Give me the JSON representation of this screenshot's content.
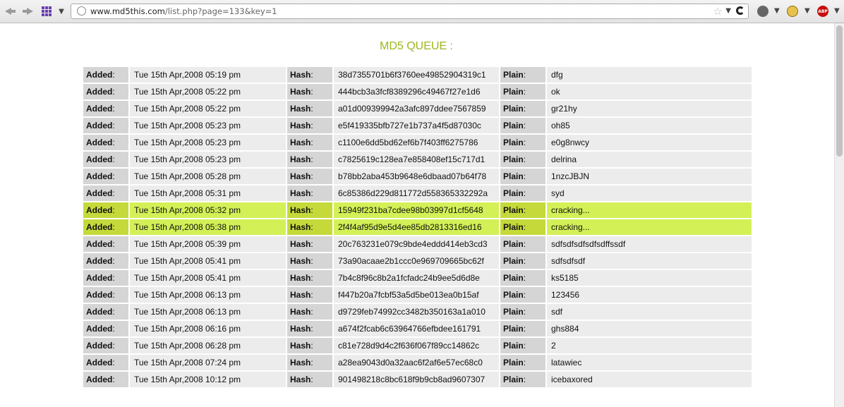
{
  "browser": {
    "url_domain": "www.md5this.com",
    "url_path": "/list.php?page=133&key=1"
  },
  "page": {
    "title": "MD5 QUEUE :"
  },
  "table": {
    "labels": {
      "added": "Added",
      "hash": "Hash",
      "plain": "Plain",
      "separator": ":"
    },
    "rows": [
      {
        "added": "Tue 15th Apr,2008 05:19 pm",
        "hash": "38d7355701b6f3760ee49852904319c1",
        "plain": "dfg",
        "status": "done"
      },
      {
        "added": "Tue 15th Apr,2008 05:22 pm",
        "hash": "444bcb3a3fcf8389296c49467f27e1d6",
        "plain": "ok",
        "status": "done"
      },
      {
        "added": "Tue 15th Apr,2008 05:22 pm",
        "hash": "a01d009399942a3afc897ddee7567859",
        "plain": "gr21hy",
        "status": "done"
      },
      {
        "added": "Tue 15th Apr,2008 05:23 pm",
        "hash": "e5f419335bfb727e1b737a4f5d87030c",
        "plain": "oh85",
        "status": "done"
      },
      {
        "added": "Tue 15th Apr,2008 05:23 pm",
        "hash": "c1100e6dd5bd62ef6b7f403ff6275786",
        "plain": "e0g8nwcy",
        "status": "done"
      },
      {
        "added": "Tue 15th Apr,2008 05:23 pm",
        "hash": "c7825619c128ea7e858408ef15c717d1",
        "plain": "delrina",
        "status": "done"
      },
      {
        "added": "Tue 15th Apr,2008 05:28 pm",
        "hash": "b78bb2aba453b9648e6dbaad07b64f78",
        "plain": "1nzcJBJN",
        "status": "done"
      },
      {
        "added": "Tue 15th Apr,2008 05:31 pm",
        "hash": "6c85386d229d811772d558365332292a",
        "plain": "syd",
        "status": "done"
      },
      {
        "added": "Tue 15th Apr,2008 05:32 pm",
        "hash": "15949f231ba7cdee98b03997d1cf5648",
        "plain": "cracking...",
        "status": "active"
      },
      {
        "added": "Tue 15th Apr,2008 05:38 pm",
        "hash": "2f4f4af95d9e5d4ee85db2813316ed16",
        "plain": "cracking...",
        "status": "active"
      },
      {
        "added": "Tue 15th Apr,2008 05:39 pm",
        "hash": "20c763231e079c9bde4eddd414eb3cd3",
        "plain": "sdfsdfsdfsdfsdffssdf",
        "status": "done"
      },
      {
        "added": "Tue 15th Apr,2008 05:41 pm",
        "hash": "73a90acaae2b1ccc0e969709665bc62f",
        "plain": "sdfsdfsdf",
        "status": "done"
      },
      {
        "added": "Tue 15th Apr,2008 05:41 pm",
        "hash": "7b4c8f96c8b2a1fcfadc24b9ee5d6d8e",
        "plain": "ks5185",
        "status": "done"
      },
      {
        "added": "Tue 15th Apr,2008 06:13 pm",
        "hash": "f447b20a7fcbf53a5d5be013ea0b15af",
        "plain": "123456",
        "status": "done"
      },
      {
        "added": "Tue 15th Apr,2008 06:13 pm",
        "hash": "d9729feb74992cc3482b350163a1a010",
        "plain": "sdf",
        "status": "done"
      },
      {
        "added": "Tue 15th Apr,2008 06:16 pm",
        "hash": "a674f2fcab6c63964766efbdee161791",
        "plain": "ghs884",
        "status": "done"
      },
      {
        "added": "Tue 15th Apr,2008 06:28 pm",
        "hash": "c81e728d9d4c2f636f067f89cc14862c",
        "plain": "2",
        "status": "done"
      },
      {
        "added": "Tue 15th Apr,2008 07:24 pm",
        "hash": "a28ea9043d0a32aac6f2af6e57ec68c0",
        "plain": "latawiec",
        "status": "done"
      },
      {
        "added": "Tue 15th Apr,2008 10:12 pm",
        "hash": "901498218c8bc618f9b9cb8ad9607307",
        "plain": "icebaxored",
        "status": "done"
      }
    ]
  },
  "colors": {
    "title": "#9bb81d",
    "active_row": "#d3f057",
    "label_cell": "#d5d5d5",
    "value_cell": "#ececec"
  },
  "icons": [
    "back-icon",
    "forward-icon",
    "apps-grid-icon",
    "globe-icon",
    "bookmark-star-icon",
    "reload-icon",
    "bug-icon",
    "face-icon",
    "adblock-icon"
  ]
}
